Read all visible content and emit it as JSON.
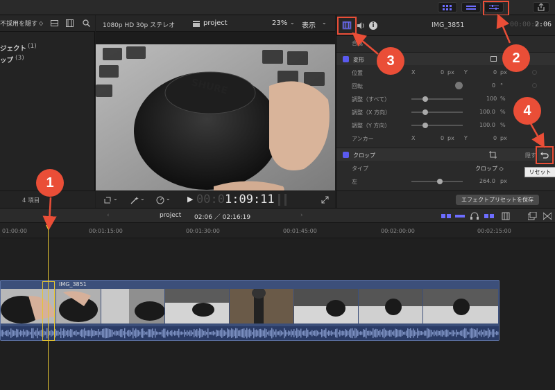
{
  "browser": {
    "filter_label": "不採用を隠す",
    "items": [
      {
        "label": "ジェクト",
        "count": "(1)"
      },
      {
        "label": "ップ",
        "count": "(3)"
      }
    ],
    "footer_count": "4 項目"
  },
  "viewer": {
    "format": "1080p HD 30p ステレオ",
    "project_name": "project",
    "zoom": "23%",
    "display_menu": "表示",
    "timecode_dim": "00:0",
    "timecode_main": "1:09:11"
  },
  "inspector": {
    "clip_name": "IMG_3851",
    "timecode_dim": "00:00:0",
    "timecode_main": "2:06",
    "compositing_label": "合成",
    "transform": {
      "title": "変形",
      "position_label": "位置",
      "x_label": "X",
      "x_value": "0",
      "x_unit": "px",
      "y_label": "Y",
      "y_value": "0",
      "y_unit": "px",
      "rotation_label": "回転",
      "rotation_value": "0",
      "rotation_unit": "°",
      "scale_all_label": "調整（すべて）",
      "scale_all_value": "100",
      "scale_all_unit": "%",
      "scale_x_label": "調整（X 方向）",
      "scale_x_value": "100.0",
      "scale_x_unit": "%",
      "scale_y_label": "調整（Y 方向）",
      "scale_y_value": "100.0",
      "scale_y_unit": "%",
      "anchor_label": "アンカー",
      "anchor_x_label": "X",
      "anchor_x_value": "0",
      "anchor_x_unit": "px",
      "anchor_y_label": "Y",
      "anchor_y_value": "0",
      "anchor_y_unit": "px"
    },
    "crop": {
      "title": "クロップ",
      "reset_partial": "隠す",
      "type_label": "タイプ",
      "type_value": "クロップ ◇",
      "left_label": "左",
      "left_value": "264.0",
      "left_unit": "px"
    },
    "tooltip": "リセット",
    "save_preset_button": "エフェクトプリセットを保存"
  },
  "timeline": {
    "project_name": "project",
    "position": "02:06 ／ 02:16:19",
    "ruler_ticks": [
      "01:00:00",
      "00:01:15:00",
      "00:01:30:00",
      "00:01:45:00",
      "00:02:00:00",
      "00:02:15:00"
    ],
    "clip_name": "IMG_3851"
  },
  "annotations": [
    "1",
    "2",
    "3",
    "4"
  ],
  "colors": {
    "accent": "#6d6dff",
    "annotation": "#ea4e37",
    "playhead": "#e6c531",
    "clip": "#3c4f7a"
  }
}
